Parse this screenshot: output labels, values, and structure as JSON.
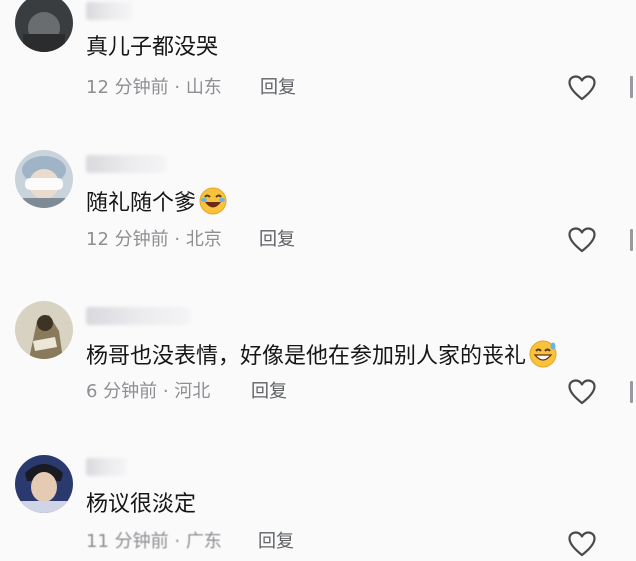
{
  "comments": [
    {
      "text": "真儿子都没哭",
      "time": "12 分钟前",
      "location": "山东",
      "reply": "回复"
    },
    {
      "text": "随礼随个爹",
      "time": "12 分钟前",
      "location": "北京",
      "reply": "回复"
    },
    {
      "text": "杨哥也没表情，好像是他在参加别人家的丧礼",
      "time": "6 分钟前",
      "location": "河北",
      "reply": "回复"
    },
    {
      "text": "杨议很淡定",
      "time": "11 分钟前",
      "location": "广东",
      "reply": "回复"
    }
  ],
  "separator": " · ",
  "icons": {
    "like": "heart-outline-icon",
    "emoji_laugh": "rolling-on-floor-laughing-emoji",
    "emoji_grin": "grinning-emoji"
  },
  "colors": {
    "background": "#fafafa",
    "meta_text": "#8e8e93",
    "heart_stroke": "#4a4a4e"
  }
}
